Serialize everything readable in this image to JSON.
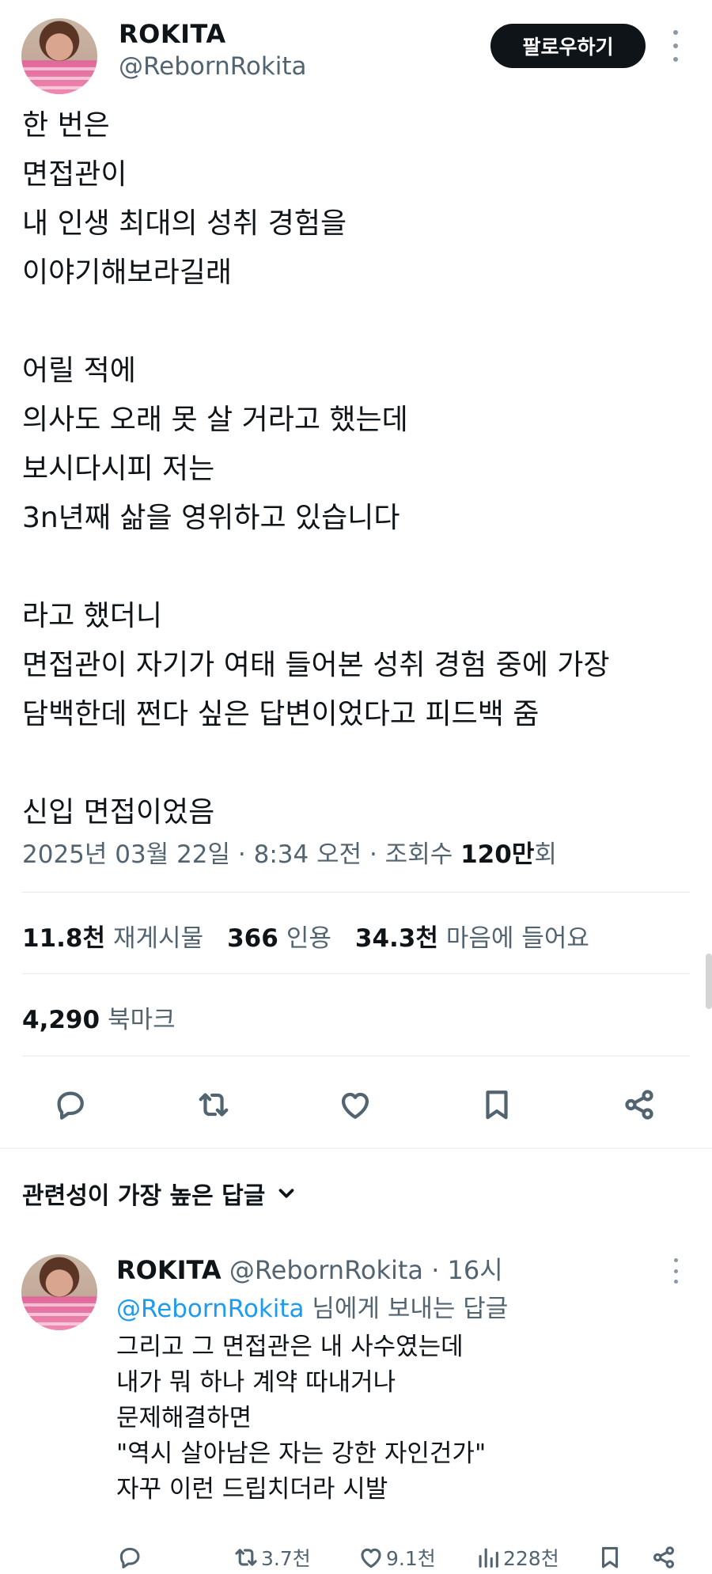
{
  "author": {
    "display_name": "ROKITA",
    "handle": "@RebornRokita",
    "follow_label": "팔로우하기"
  },
  "post": {
    "text": "한 번은\n면접관이\n내 인생 최대의 성취 경험을\n이야기해보라길래\n\n어릴 적에\n의사도 오래 못 살 거라고 했는데\n보시다시피 저는\n3n년째 삶을 영위하고 있습니다\n\n라고 했더니\n면접관이 자기가 여태 들어본 성취 경험 중에 가장\n담백한데 쩐다 싶은 답변이었다고 피드백 줌\n\n신입 면접이었음",
    "date_time": "2025년 03월 22일 · 8:34 오전 · 조회수 ",
    "views_count": "120만",
    "views_suffix": "회"
  },
  "stats": {
    "reposts_count": "11.8천",
    "reposts_label": "재게시물",
    "quotes_count": "366",
    "quotes_label": "인용",
    "likes_count": "34.3천",
    "likes_label": "마음에 들어요",
    "bookmarks_count": "4,290",
    "bookmarks_label": "북마크"
  },
  "replies_section": {
    "sort_label": "관련성이 가장 높은 답글"
  },
  "reply": {
    "display_name": "ROKITA",
    "handle": "@RebornRokita",
    "separator": " · ",
    "time": "16시",
    "replying_mention": "@RebornRokita",
    "replying_suffix": " 님에게 보내는 답글",
    "text": "그리고 그 면접관은 내 사수였는데\n내가 뭐 하나 계약 따내거나\n문제해결하면\n\"역시 살아남은 자는 강한 자인건가\"\n자꾸 이런 드립치더라 시발",
    "repost_count": "3.7천",
    "like_count": "9.1천",
    "view_count": "228천"
  },
  "colors": {
    "text": "#0f1419",
    "secondary": "#536471",
    "link": "#1d9bf0",
    "divider": "#e7e9ea"
  },
  "icons": [
    "more-vertical-icon",
    "reply-icon",
    "repost-icon",
    "heart-icon",
    "bookmark-icon",
    "share-icon",
    "chevron-down-icon",
    "views-icon"
  ]
}
